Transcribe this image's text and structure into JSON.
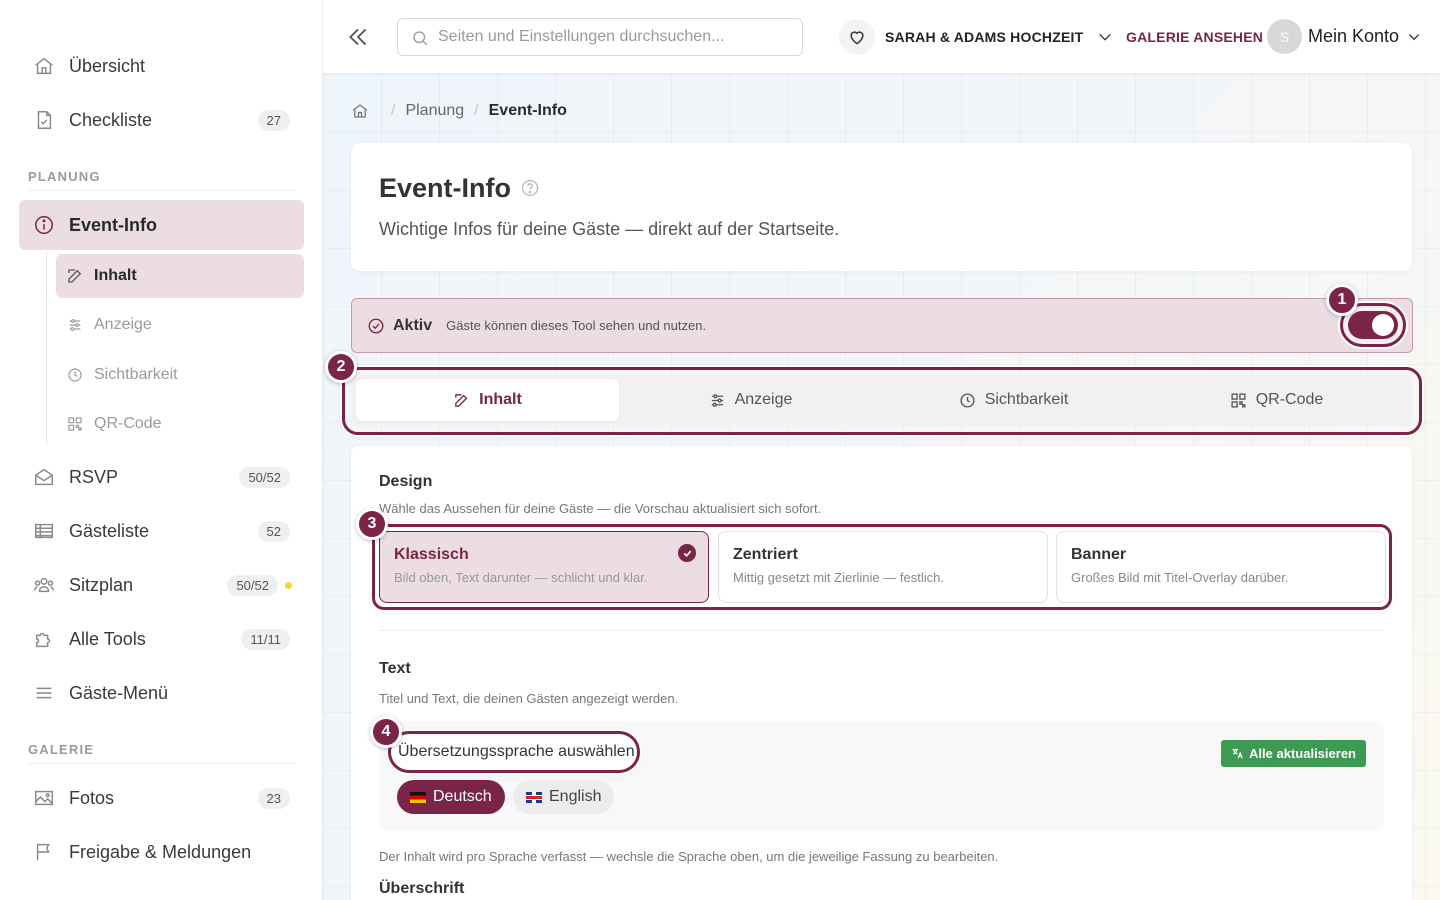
{
  "sidebar": {
    "items_top": [
      {
        "label": "Übersicht",
        "icon": "home-icon"
      },
      {
        "label": "Checkliste",
        "icon": "checklist-icon",
        "badge": "27"
      }
    ],
    "section_planung": "PLANUNG",
    "event_info": {
      "label": "Event-Info",
      "icon": "info-icon"
    },
    "sub_items": [
      {
        "label": "Inhalt",
        "icon": "edit-icon"
      },
      {
        "label": "Anzeige",
        "icon": "sliders-icon"
      },
      {
        "label": "Sichtbarkeit",
        "icon": "clock-icon"
      },
      {
        "label": "QR-Code",
        "icon": "qr-icon"
      }
    ],
    "items_planung": [
      {
        "label": "RSVP",
        "icon": "envelope-icon",
        "badge": "50/52"
      },
      {
        "label": "Gästeliste",
        "icon": "table-icon",
        "badge": "52"
      },
      {
        "label": "Sitzplan",
        "icon": "people-icon",
        "badge": "50/52"
      },
      {
        "label": "Alle Tools",
        "icon": "puzzle-icon",
        "badge": "11/11"
      },
      {
        "label": "Gäste-Menü",
        "icon": "menu-icon"
      }
    ],
    "section_galerie": "GALERIE",
    "items_galerie": [
      {
        "label": "Fotos",
        "icon": "image-icon",
        "badge": "23"
      },
      {
        "label": "Freigabe & Meldungen",
        "icon": "flag-icon"
      }
    ]
  },
  "topbar": {
    "search_placeholder": "Seiten und Einstellungen durchsuchen...",
    "event_name": "SARAH & ADAMS HOCHZEIT",
    "gallery_link": "GALERIE ANSEHEN",
    "avatar_initial": "S",
    "account_label": "Mein Konto"
  },
  "breadcrumb": {
    "parent": "Planung",
    "current": "Event-Info"
  },
  "header": {
    "title": "Event-Info",
    "subtitle": "Wichtige Infos für deine Gäste — direkt auf der Startseite."
  },
  "active_bar": {
    "label": "Aktiv",
    "description": "Gäste können dieses Tool sehen und nutzen.",
    "enabled": true
  },
  "tour_badges": [
    "1",
    "2",
    "3",
    "4"
  ],
  "tabs": [
    {
      "label": "Inhalt",
      "icon": "edit-icon"
    },
    {
      "label": "Anzeige",
      "icon": "sliders-icon"
    },
    {
      "label": "Sichtbarkeit",
      "icon": "clock-icon"
    },
    {
      "label": "QR-Code",
      "icon": "qr-icon"
    }
  ],
  "design": {
    "title": "Design",
    "description": "Wähle das Aussehen für deine Gäste — die Vorschau aktualisiert sich sofort.",
    "options": [
      {
        "title": "Klassisch",
        "description": "Bild oben, Text darunter — schlicht und klar.",
        "selected": true
      },
      {
        "title": "Zentriert",
        "description": "Mittig gesetzt mit Zierlinie — festlich.",
        "selected": false
      },
      {
        "title": "Banner",
        "description": "Großes Bild mit Titel-Overlay darüber.",
        "selected": false
      }
    ]
  },
  "text_section": {
    "title": "Text",
    "description": "Titel und Text, die deinen Gästen angezeigt werden.",
    "language_label": "Übersetzungssprache auswählen",
    "update_all": "Alle aktualisieren",
    "languages": [
      {
        "label": "Deutsch",
        "selected": true
      },
      {
        "label": "English",
        "selected": false
      }
    ],
    "note": "Der Inhalt wird pro Sprache verfasst — wechsle die Sprache oben, um die jeweilige Fassung zu bearbeiten.",
    "heading_label": "Überschrift"
  },
  "colors": {
    "accent": "#7a2447",
    "accent_light": "#ecdde2",
    "success": "#3c9a52"
  }
}
